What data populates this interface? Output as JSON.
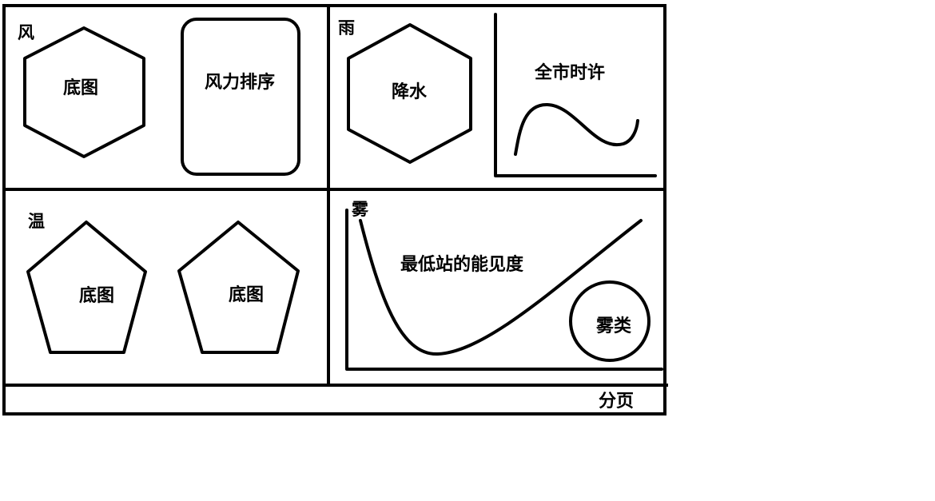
{
  "sections": {
    "wind": {
      "title": "风",
      "hexagon_label": "底图",
      "card_label": "风力排序"
    },
    "rain": {
      "title": "雨",
      "hexagon_label": "降水",
      "chart_label": "全市时许"
    },
    "temperature": {
      "title": "温",
      "pentagon_left_label": "底图",
      "pentagon_right_label": "底图"
    },
    "fog": {
      "title": "雾",
      "chart_label": "最低站的能见度",
      "circle_label": "雾类"
    }
  },
  "footer": {
    "pagination_label": "分页"
  }
}
